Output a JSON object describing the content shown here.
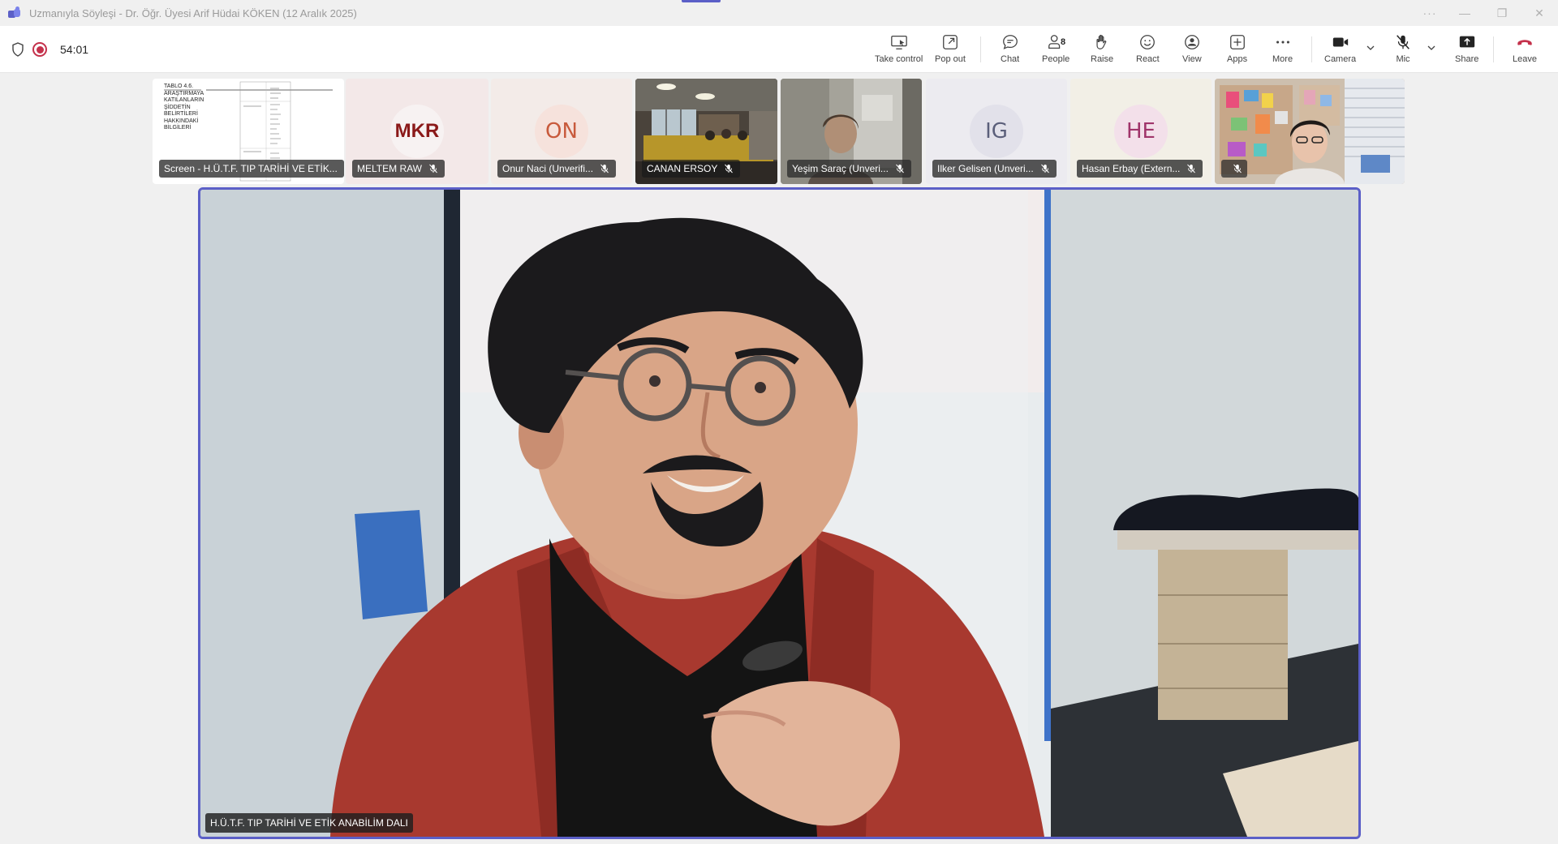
{
  "window": {
    "title": "Uzmanıyla Söyleşi - Dr. Öğr. Üyesi Arif Hüdai KÖKEN (12 Aralık 2025)",
    "controls": {
      "more": "···",
      "minimize": "—",
      "restore": "❐",
      "close": "✕"
    }
  },
  "status": {
    "timer": "54:01",
    "recording": true
  },
  "toolbar": {
    "take_control": "Take control",
    "pop_out": "Pop out",
    "chat": "Chat",
    "people": "People",
    "people_count": "8",
    "raise": "Raise",
    "react": "React",
    "view": "View",
    "apps": "Apps",
    "more": "More",
    "camera": "Camera",
    "mic": "Mic",
    "share": "Share",
    "leave": "Leave"
  },
  "screen_share": {
    "label": "Screen - H.Ü.T.F. TIP TARİHİ VE ETİK...",
    "doc_heading": "TABLO 4.6. ARAŞTIRMAYA KATILANLARIN ŞİDDETİN BELİRTİLERİ HAKKINDAKİ BİLGİLERİ"
  },
  "participants": [
    {
      "name": "MELTEM RAW",
      "initials": "MKR",
      "type": "logo"
    },
    {
      "name": "Onur Naci (Unverifi...",
      "initials": "ON",
      "type": "avatar",
      "color": "#c85a3c",
      "bg": "#f6e2dc"
    },
    {
      "name": "CANAN ERSOY",
      "type": "video"
    },
    {
      "name": "Yeşim Saraç (Unveri...",
      "type": "video"
    },
    {
      "name": "Ilker Gelisen (Unveri...",
      "initials": "IG",
      "type": "avatar",
      "color": "#5b5f7a",
      "bg": "#e6e6f0"
    },
    {
      "name": "Hasan Erbay (Extern...",
      "initials": "HE",
      "type": "avatar",
      "color": "#a0356b",
      "bg": "#f3e0ea"
    },
    {
      "name": "",
      "type": "video"
    }
  ],
  "main_stage": {
    "label": "H.Ü.T.F. TIP TARİHİ VE ETİK ANABİLİM DALI"
  },
  "colors": {
    "accent": "#5b5fc7",
    "leave": "#c4314b",
    "recording": "#c4314b"
  }
}
